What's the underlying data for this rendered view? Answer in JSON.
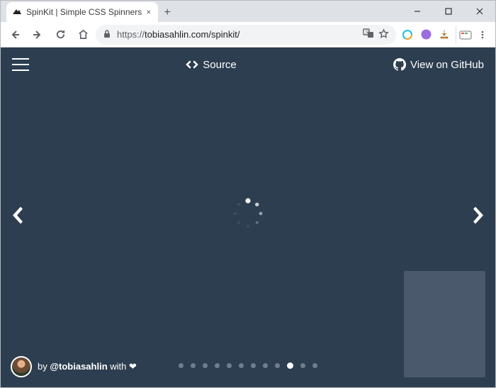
{
  "browser": {
    "tab_title": "SpinKit | Simple CSS Spinners",
    "url_protocol": "https://",
    "url_rest": "tobiasahlin.com/spinkit/",
    "window": {
      "minimize": "–",
      "maximize": "□",
      "close": "×"
    }
  },
  "header": {
    "source_label": "Source",
    "github_label": "View on GitHub"
  },
  "footer": {
    "prefix": "by ",
    "handle": "@tobiasahlin",
    "suffix": " with "
  },
  "pager": {
    "total_dots": 12,
    "active_index": 9
  },
  "spinner": {
    "dot_count": 8
  },
  "colors": {
    "page_bg": "#2c3e50"
  }
}
